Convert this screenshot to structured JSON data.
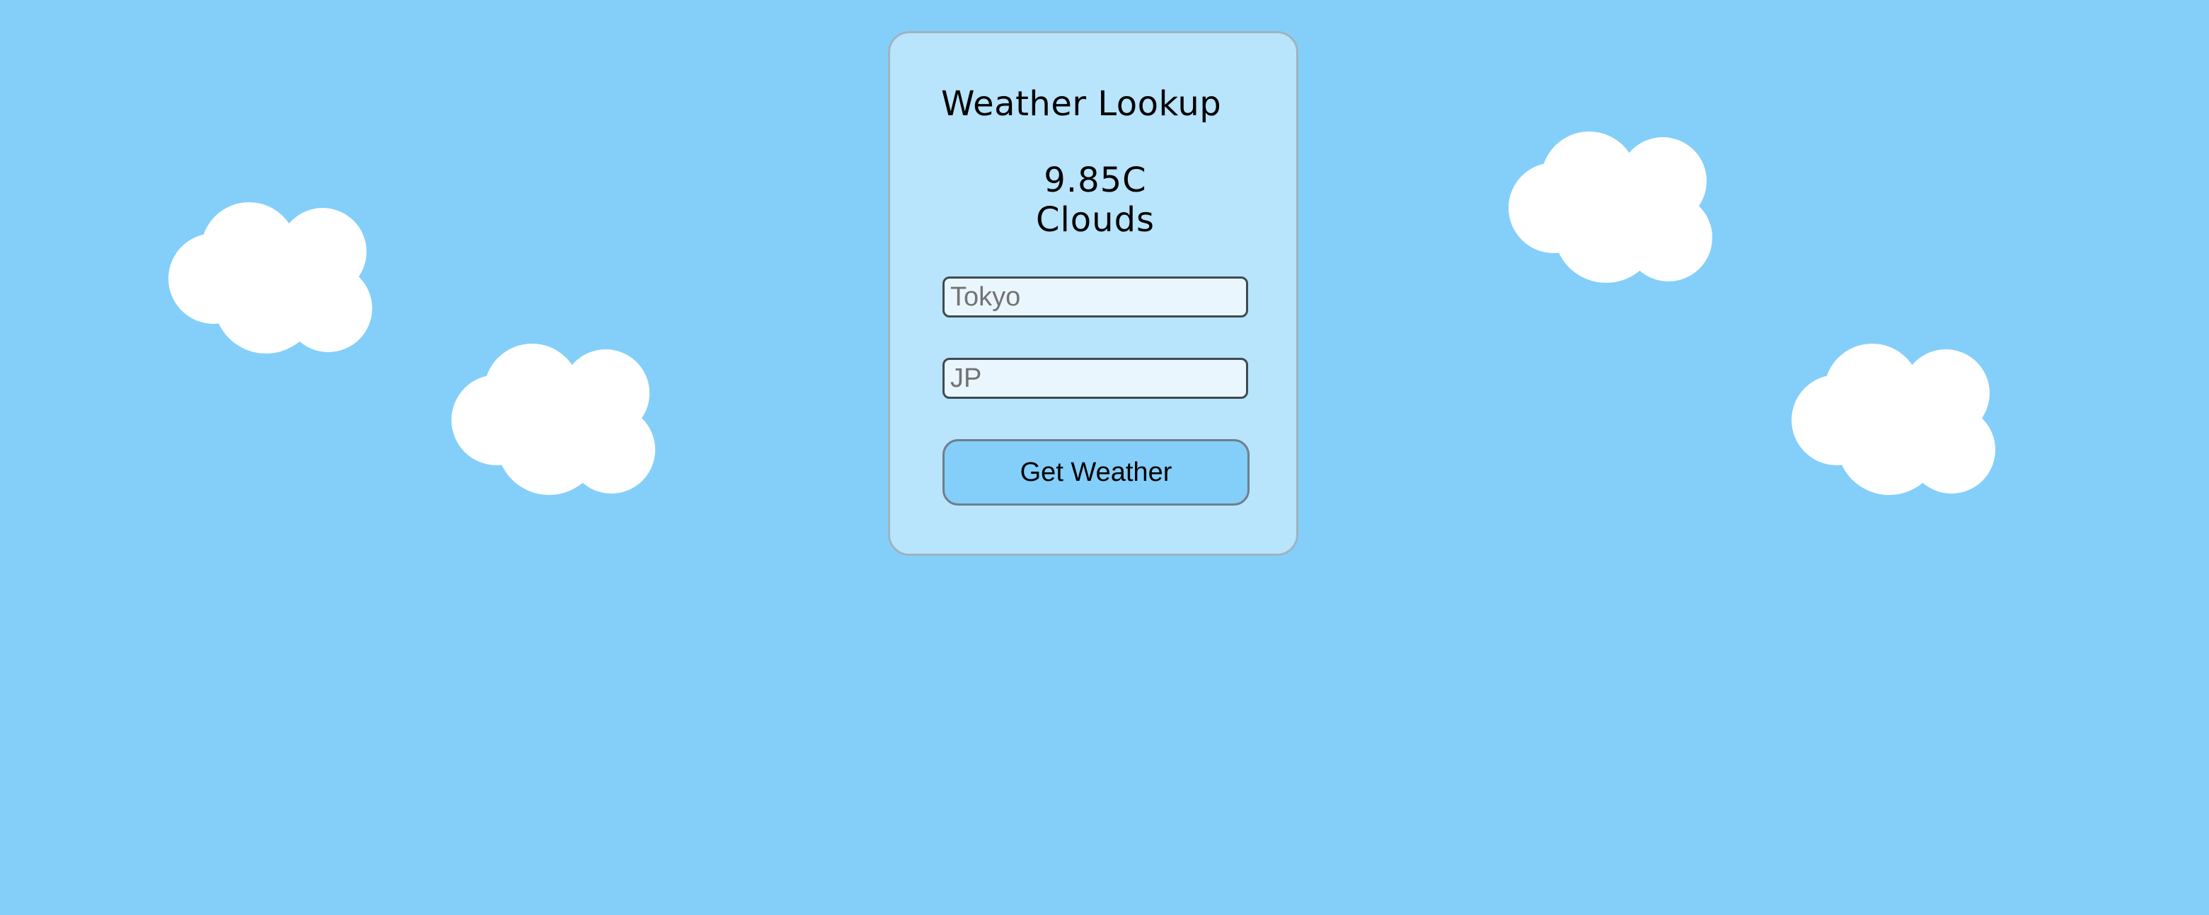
{
  "card": {
    "title": "Weather Lookup",
    "temperature": "9.85C",
    "condition": "Clouds"
  },
  "form": {
    "city_placeholder": "Tokyo",
    "country_placeholder": "JP",
    "submit_label": "Get Weather"
  },
  "colors": {
    "background": "#84cffa",
    "card": "#b8e4fc",
    "cloud": "#ffffff"
  }
}
